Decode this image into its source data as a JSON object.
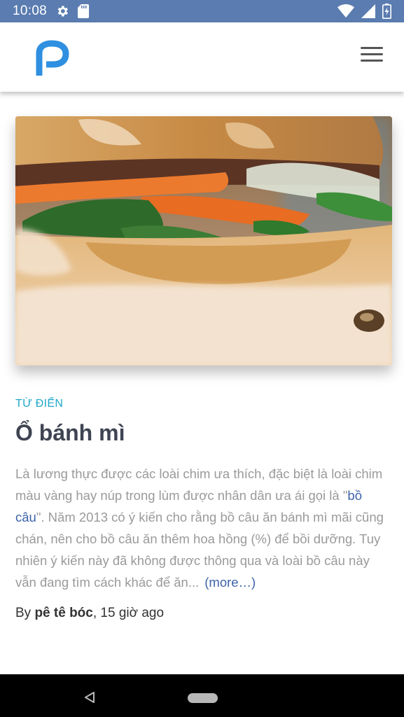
{
  "status_bar": {
    "time": "10:08",
    "icons": [
      "gear-icon",
      "sd-card-icon",
      "wifi-icon",
      "signal-icon",
      "battery-charging-icon"
    ],
    "color": "#5a7cb0"
  },
  "header": {
    "logo": "p-logo",
    "logo_color": "#2f8fe0",
    "menu_icon": "hamburger-menu-icon"
  },
  "article": {
    "image": "banh-mi-sandwich-photo",
    "category": "TỪ ĐIỂN",
    "title": "Ổ bánh mì",
    "excerpt_before_link": "Là lương thực được các loài chim ưa thích, đặc biệt là loài chim màu vàng hay núp trong lùm được nhân dân ưa ái gọi là \"",
    "excerpt_link": "bồ câu",
    "excerpt_after_link": "\". Năm 2013 có ý kiến cho rằng bồ câu ăn bánh mì mãi cũng chán, nên cho bồ câu ăn thêm hoa hồng (%) để bồi dưỡng. Tuy nhiên ý kiến này đã không được thông qua và loài bồ câu này vẫn đang tìm cách khác để ăn...",
    "more_label": "(more…)",
    "byline_prefix": "By ",
    "author": "pê tê bóc",
    "time_ago": ", 15 giờ ago",
    "accent_color": "#1fa8c9"
  },
  "nav_bar": {
    "back_icon": "back-triangle-icon",
    "home_icon": "home-pill-icon"
  }
}
